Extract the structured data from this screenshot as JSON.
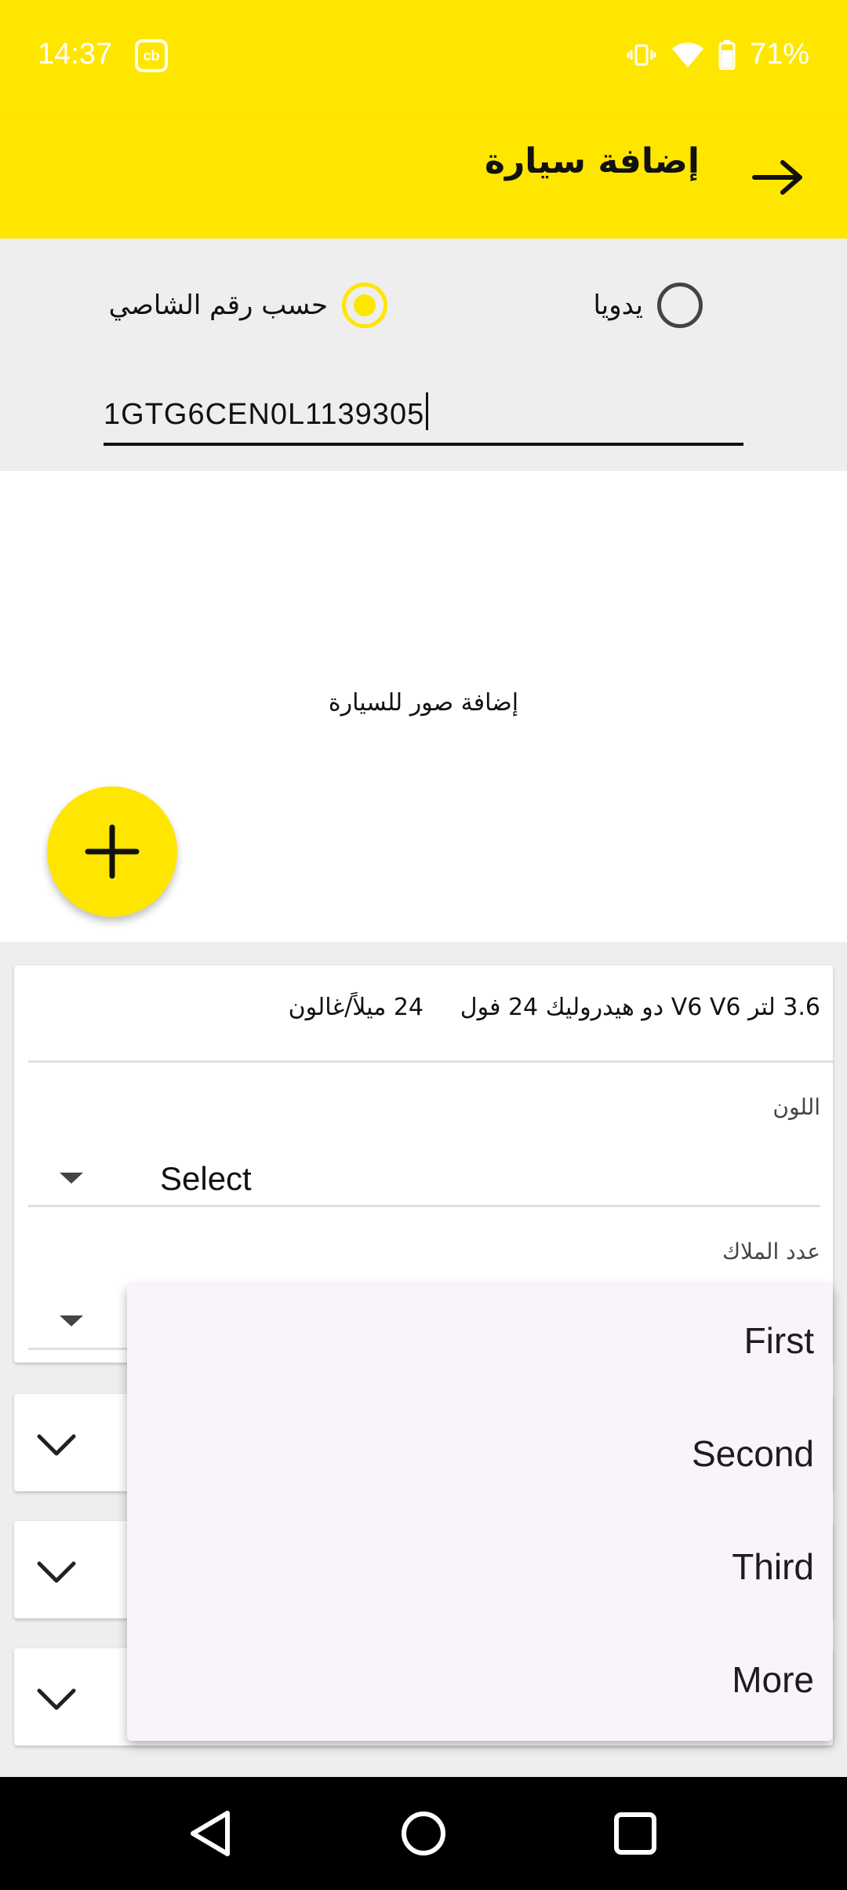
{
  "status_bar": {
    "time": "14:37",
    "app_badge": "cb",
    "battery": "71%"
  },
  "app_bar": {
    "title": "إضافة سيارة"
  },
  "mode": {
    "options": [
      {
        "label": "حسب رقم الشاصي",
        "selected": true
      },
      {
        "label": "يدويا",
        "selected": false
      }
    ],
    "vin_value": "1GTG6CEN0L1139305"
  },
  "photos": {
    "label": "إضافة صور للسيارة"
  },
  "details": {
    "engine": "3.6 لتر V6 V6 دو هيدروليك 24 فول",
    "mpg": "24 ميلاً/غالون",
    "color_label": "اللون",
    "color_value": "Select",
    "owners_label": "عدد الملاك"
  },
  "owners_menu": {
    "options": [
      "First",
      "Second",
      "Third",
      "More"
    ]
  },
  "colors": {
    "accent": "#ffe600",
    "menu_bg": "#fbf3fb"
  }
}
